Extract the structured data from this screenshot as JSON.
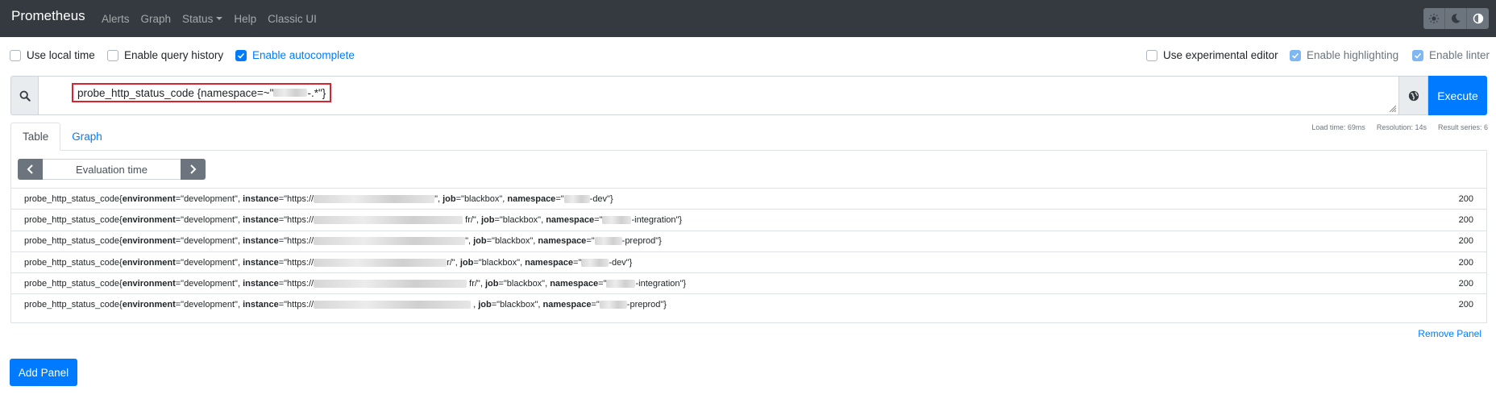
{
  "navbar": {
    "brand": "Prometheus",
    "links": [
      "Alerts",
      "Graph",
      "Status",
      "Help",
      "Classic UI"
    ]
  },
  "options": {
    "use_local_time": "Use local time",
    "enable_query_history": "Enable query history",
    "enable_autocomplete": "Enable autocomplete",
    "use_experimental_editor": "Use experimental editor",
    "enable_highlighting": "Enable highlighting",
    "enable_linter": "Enable linter"
  },
  "query": {
    "prefix": "probe_http_status_code {namespace=~\"",
    "suffix": "-.*\"}",
    "execute_label": "Execute"
  },
  "stats": {
    "load_time": "Load time: 69ms",
    "resolution": "Resolution: 14s",
    "result_series": "Result series: 6"
  },
  "tabs": {
    "table": "Table",
    "graph": "Graph"
  },
  "eval_time": {
    "placeholder": "Evaluation time"
  },
  "results": [
    {
      "metric": "probe_http_status_code{",
      "env_key": "environment",
      "env_val": "=\"development\", ",
      "inst_key": "instance",
      "inst_pre": "=\"https://",
      "inst_post": "\", ",
      "job_key": "job",
      "job_val": "=\"blackbox\", ",
      "ns_key": "namespace",
      "ns_pre": "=\"",
      "ns_post": "-dev\"}",
      "value": "200"
    },
    {
      "metric": "probe_http_status_code{",
      "env_key": "environment",
      "env_val": "=\"development\", ",
      "inst_key": "instance",
      "inst_pre": "=\"https://",
      "inst_post": " fr/\", ",
      "job_key": "job",
      "job_val": "=\"blackbox\", ",
      "ns_key": "namespace",
      "ns_pre": "=\"",
      "ns_post": "-integration\"}",
      "value": "200"
    },
    {
      "metric": "probe_http_status_code{",
      "env_key": "environment",
      "env_val": "=\"development\", ",
      "inst_key": "instance",
      "inst_pre": "=\"https://",
      "inst_post": "\", ",
      "job_key": "job",
      "job_val": "=\"blackbox\", ",
      "ns_key": "namespace",
      "ns_pre": "=\"",
      "ns_post": "-preprod\"}",
      "value": "200"
    },
    {
      "metric": "probe_http_status_code{",
      "env_key": "environment",
      "env_val": "=\"development\", ",
      "inst_key": "instance",
      "inst_pre": "=\"https://",
      "inst_post": "r/\", ",
      "job_key": "job",
      "job_val": "=\"blackbox\", ",
      "ns_key": "namespace",
      "ns_pre": "=\"",
      "ns_post": "-dev\"}",
      "value": "200"
    },
    {
      "metric": "probe_http_status_code{",
      "env_key": "environment",
      "env_val": "=\"development\", ",
      "inst_key": "instance",
      "inst_pre": "=\"https://",
      "inst_post": " fr/\", ",
      "job_key": "job",
      "job_val": "=\"blackbox\", ",
      "ns_key": "namespace",
      "ns_pre": "=\"",
      "ns_post": "-integration\"}",
      "value": "200"
    },
    {
      "metric": "probe_http_status_code{",
      "env_key": "environment",
      "env_val": "=\"development\", ",
      "inst_key": "instance",
      "inst_pre": "=\"https://",
      "inst_post": " , ",
      "job_key": "job",
      "job_val": "=\"blackbox\", ",
      "ns_key": "namespace",
      "ns_pre": "=\"",
      "ns_post": "-preprod\"}",
      "value": "200"
    }
  ],
  "remove_panel": "Remove Panel",
  "add_panel": "Add Panel",
  "colors": {
    "navbar": "#343a40",
    "primary": "#007bff",
    "highlight_box": "#d9232e"
  }
}
